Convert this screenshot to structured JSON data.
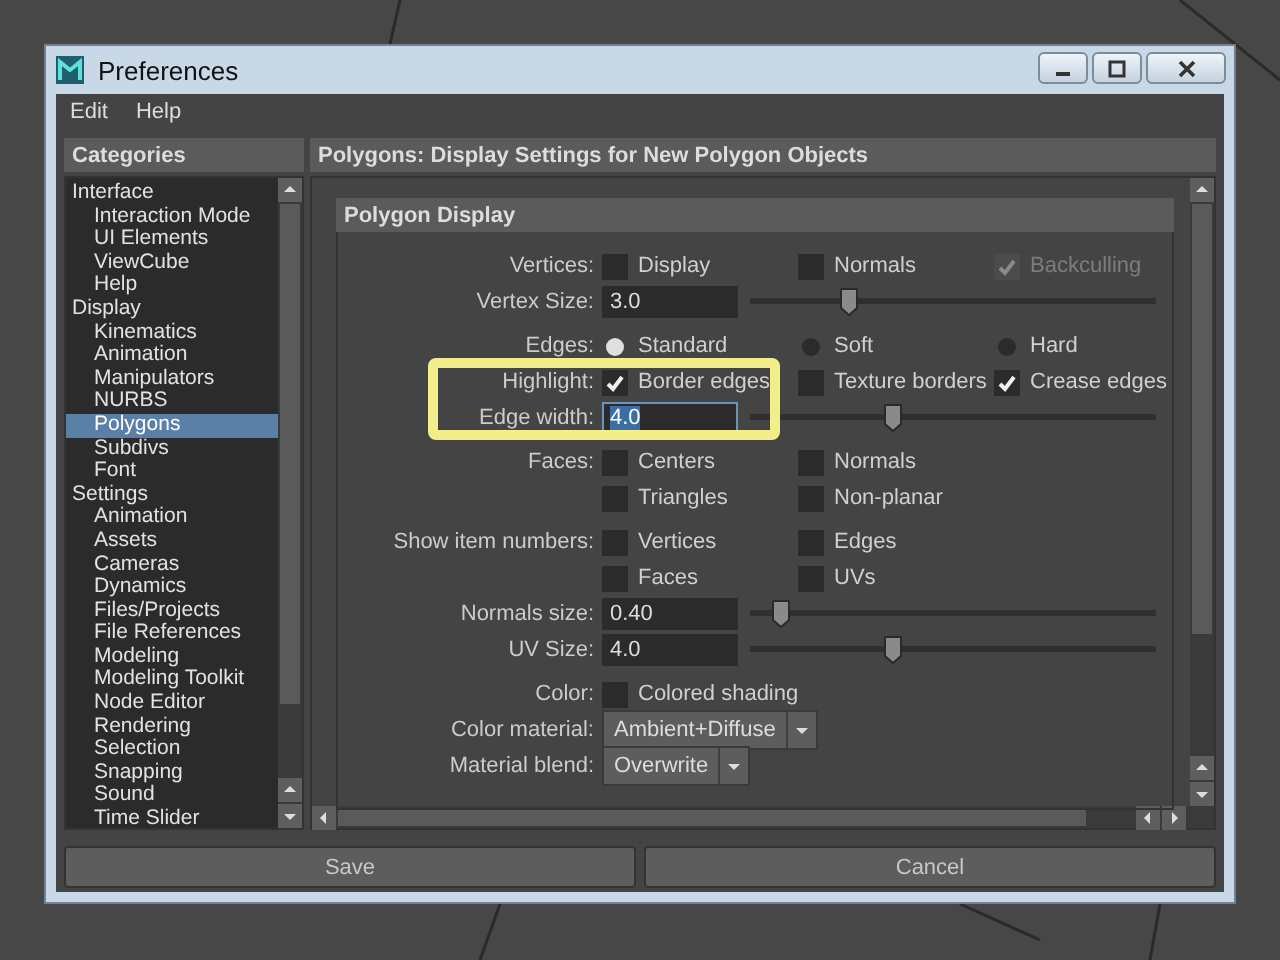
{
  "window": {
    "title": "Preferences"
  },
  "menu": [
    "Edit",
    "Help"
  ],
  "categories": {
    "title": "Categories",
    "items": [
      {
        "label": "Interface",
        "selected": false,
        "children": [
          {
            "label": "Interaction Mode",
            "selected": false
          },
          {
            "label": "UI Elements",
            "selected": false
          },
          {
            "label": "ViewCube",
            "selected": false
          },
          {
            "label": "Help",
            "selected": false
          }
        ]
      },
      {
        "label": "Display",
        "selected": false,
        "children": [
          {
            "label": "Kinematics",
            "selected": false
          },
          {
            "label": "Animation",
            "selected": false
          },
          {
            "label": "Manipulators",
            "selected": false
          },
          {
            "label": "NURBS",
            "selected": false
          },
          {
            "label": "Polygons",
            "selected": true
          },
          {
            "label": "Subdivs",
            "selected": false
          },
          {
            "label": "Font",
            "selected": false
          }
        ]
      },
      {
        "label": "Settings",
        "selected": false,
        "children": [
          {
            "label": "Animation",
            "selected": false
          },
          {
            "label": "Assets",
            "selected": false
          },
          {
            "label": "Cameras",
            "selected": false
          },
          {
            "label": "Dynamics",
            "selected": false
          },
          {
            "label": "Files/Projects",
            "selected": false
          },
          {
            "label": "File References",
            "selected": false
          },
          {
            "label": "Modeling",
            "selected": false
          },
          {
            "label": "Modeling Toolkit",
            "selected": false
          },
          {
            "label": "Node Editor",
            "selected": false
          },
          {
            "label": "Rendering",
            "selected": false
          },
          {
            "label": "Selection",
            "selected": false
          },
          {
            "label": "Snapping",
            "selected": false
          },
          {
            "label": "Sound",
            "selected": false
          },
          {
            "label": "Time Slider",
            "selected": false
          }
        ]
      }
    ]
  },
  "panel": {
    "title": "Polygons: Display Settings for New Polygon Objects",
    "section": "Polygon Display",
    "rows": [
      {
        "kind": "checks",
        "label": "Vertices:",
        "options": [
          {
            "label": "Display",
            "checked": false,
            "disabled": false
          },
          {
            "label": "Normals",
            "checked": false,
            "disabled": false
          },
          {
            "label": "Backculling",
            "checked": true,
            "disabled": true
          }
        ]
      },
      {
        "kind": "slider",
        "label": "Vertex Size:",
        "value": "3.0",
        "level": 0.23,
        "focused": false
      },
      {
        "kind": "radios",
        "label": "Edges:",
        "options": [
          {
            "label": "Standard",
            "selected": true
          },
          {
            "label": "Soft",
            "selected": false
          },
          {
            "label": "Hard",
            "selected": false
          }
        ]
      },
      {
        "kind": "checks",
        "label": "Highlight:",
        "options": [
          {
            "label": "Border edges",
            "checked": true,
            "disabled": false
          },
          {
            "label": "Texture borders",
            "checked": false,
            "disabled": false
          },
          {
            "label": "Crease edges",
            "checked": true,
            "disabled": false
          }
        ]
      },
      {
        "kind": "slider",
        "label": "Edge width:",
        "value": "4.0",
        "level": 0.34,
        "focused": true
      },
      {
        "kind": "checks",
        "label": "Faces:",
        "options": [
          {
            "label": "Centers",
            "checked": false,
            "disabled": false
          },
          {
            "label": "Normals",
            "checked": false,
            "disabled": false
          }
        ]
      },
      {
        "kind": "checks",
        "options": [
          {
            "label": "Triangles",
            "checked": false,
            "disabled": false
          },
          {
            "label": "Non-planar",
            "checked": false,
            "disabled": false
          }
        ]
      },
      {
        "kind": "checks",
        "label": "Show item numbers:",
        "options": [
          {
            "label": "Vertices",
            "checked": false,
            "disabled": false
          },
          {
            "label": "Edges",
            "checked": false,
            "disabled": false
          }
        ]
      },
      {
        "kind": "checks",
        "options": [
          {
            "label": "Faces",
            "checked": false,
            "disabled": false
          },
          {
            "label": "UVs",
            "checked": false,
            "disabled": false
          }
        ]
      },
      {
        "kind": "slider",
        "label": "Normals size:",
        "value": "0.40",
        "level": 0.05,
        "focused": false
      },
      {
        "kind": "slider",
        "label": "UV Size:",
        "value": "4.0",
        "level": 0.34,
        "focused": false
      },
      {
        "kind": "checks",
        "label": "Color:",
        "options": [
          {
            "label": "Colored shading",
            "checked": false,
            "disabled": false
          }
        ]
      },
      {
        "kind": "dropdown",
        "label": "Color material:",
        "value": "Ambient+Diffuse"
      },
      {
        "kind": "dropdown",
        "label": "Material blend:",
        "value": "Overwrite"
      }
    ]
  },
  "buttons": [
    "Save",
    "Cancel"
  ]
}
